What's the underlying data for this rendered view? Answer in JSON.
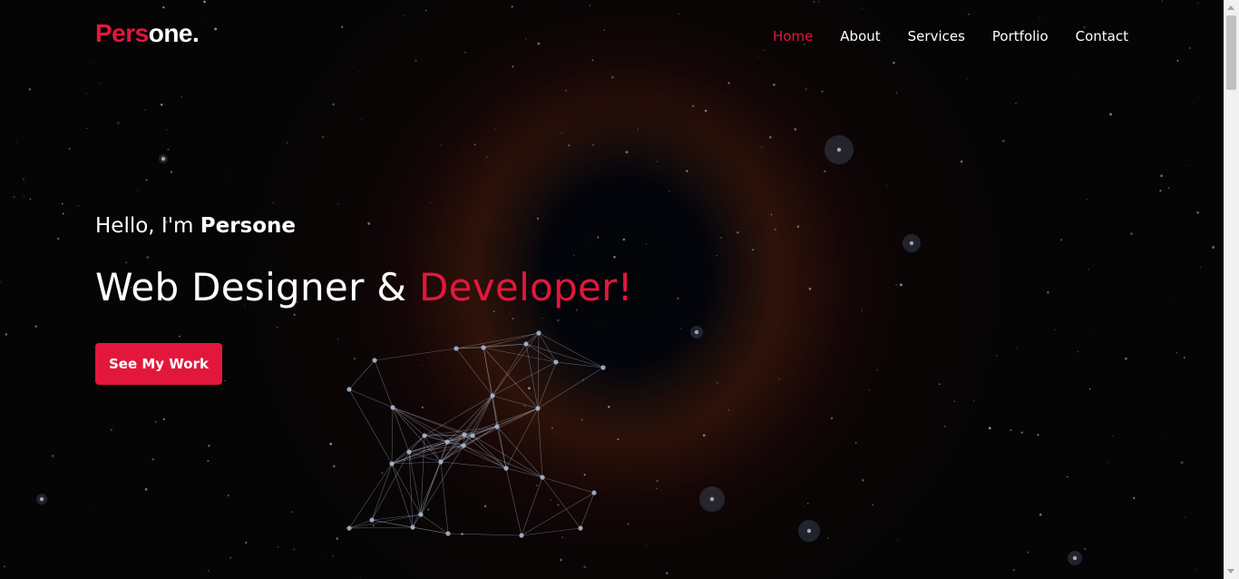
{
  "brand": {
    "logo_part1": "Pers",
    "logo_part2": "one."
  },
  "nav": {
    "items": [
      {
        "label": "Home",
        "active": true
      },
      {
        "label": "About",
        "active": false
      },
      {
        "label": "Services",
        "active": false
      },
      {
        "label": "Portfolio",
        "active": false
      },
      {
        "label": "Contact",
        "active": false
      }
    ]
  },
  "hero": {
    "greeting_prefix": "Hello, I'm ",
    "greeting_name": "Persone",
    "headline_prefix": "Web Designer & ",
    "headline_accent": "Developer!",
    "cta_label": "See My Work"
  },
  "colors": {
    "accent": "#e3173c",
    "text": "#ffffff",
    "background": "#0a0809"
  }
}
